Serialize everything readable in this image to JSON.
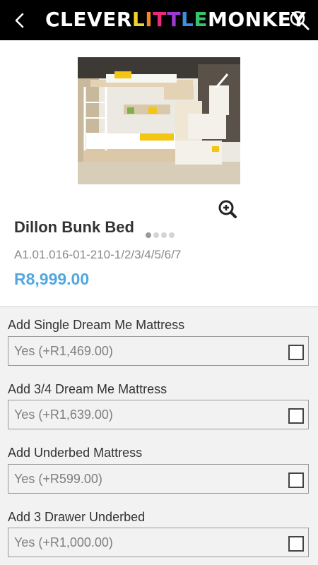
{
  "header": {
    "logo_parts": [
      {
        "text": "CLEVER",
        "color": "#ffffff"
      },
      {
        "text": "L",
        "color": "#f5d130"
      },
      {
        "text": "I",
        "color": "#f08a24"
      },
      {
        "text": "T",
        "color": "#ec2a7b"
      },
      {
        "text": "T",
        "color": "#9d3ad3"
      },
      {
        "text": "L",
        "color": "#3a8fe0"
      },
      {
        "text": "E",
        "color": "#38c46b"
      },
      {
        "text": "MONKEY",
        "color": "#ffffff"
      }
    ],
    "back_icon": "chevron-left-icon",
    "search_icon": "search-icon"
  },
  "product": {
    "title": "Dillon Bunk Bed",
    "sku": "A1.01.016-01-210-1/2/3/4/5/6/7",
    "price": "R8,999.00",
    "image_dots": 4,
    "active_dot": 0,
    "price_color": "#52a7e0"
  },
  "options": [
    {
      "label": "Add Single Dream Me Mattress",
      "value": "Yes (+R1,469.00)",
      "checked": false
    },
    {
      "label": "Add 3/4 Dream Me Mattress",
      "value": "Yes (+R1,639.00)",
      "checked": false
    },
    {
      "label": "Add Underbed Mattress",
      "value": "Yes (+R599.00)",
      "checked": false
    },
    {
      "label": "Add 3 Drawer Underbed",
      "value": "Yes (+R1,000.00)",
      "checked": false
    }
  ]
}
